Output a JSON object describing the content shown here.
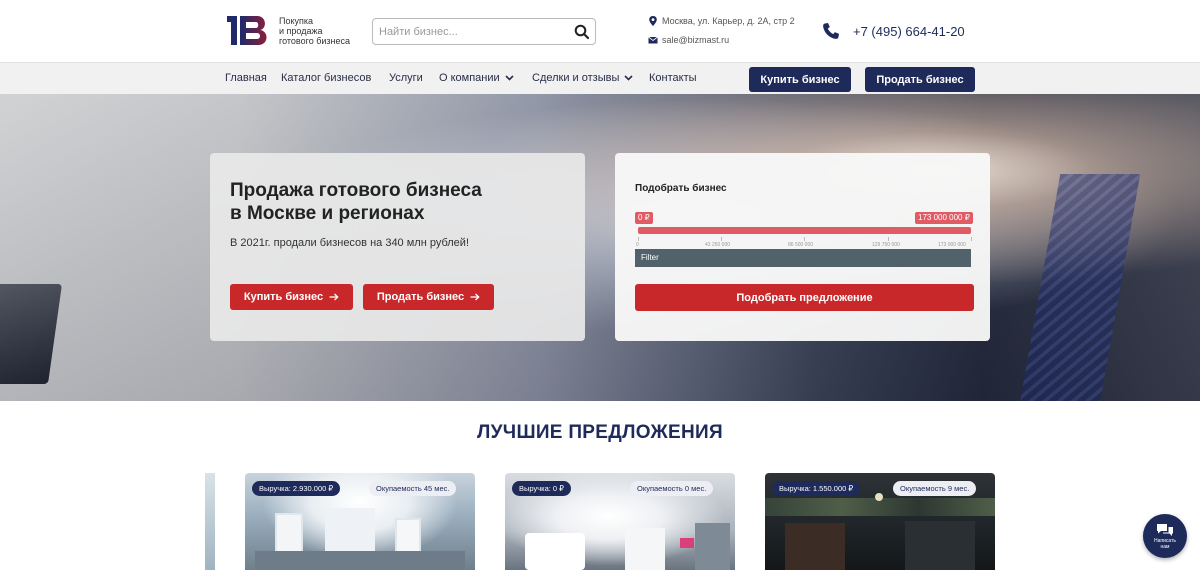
{
  "header": {
    "logo_text": "IB",
    "tagline": [
      "Покупка",
      "и продажа",
      "готового бизнеса"
    ],
    "search": {
      "placeholder": "Найти бизнес..."
    },
    "address": "Москва, ул. Карьер, д. 2А, стр 2",
    "email": "sale@bizmast.ru",
    "phone": "+7 (495) 664-41-20"
  },
  "nav": {
    "items": [
      {
        "label": "Главная"
      },
      {
        "label": "Каталог бизнесов"
      },
      {
        "label": "Услуги"
      },
      {
        "label": "О компании"
      },
      {
        "label": "Сделки и отзывы"
      },
      {
        "label": "Контакты"
      }
    ],
    "buy_button": "Купить бизнес",
    "sell_button": "Продать бизнес"
  },
  "hero": {
    "title_line1": "Продажа готового бизнеса",
    "title_line2": "в Москве и регионах",
    "subtitle": "В 2021г. продали бизнесов на 340 млн рублей!",
    "buy_button": "Купить бизнес",
    "sell_button": "Продать бизнес"
  },
  "filter": {
    "title": "Подобрать бизнес",
    "min_label": "0 ₽",
    "max_label": "173 000 000 ₽",
    "ticks": [
      "0",
      "43 250 000",
      "86 500 000",
      "129 750 000",
      "173 000 000"
    ],
    "filter_label": "Filter",
    "submit_button": "Подобрать предложение"
  },
  "best": {
    "title": "ЛУЧШИЕ ПРЕДЛОЖЕНИЯ",
    "cards": [
      {
        "revenue": "Выручка: 2.930.000 ₽",
        "payback": "Окупаемость 45 мес."
      },
      {
        "revenue": "Выручка: 0 ₽",
        "payback": "Окупаемость 0 мес."
      },
      {
        "revenue": "Выручка: 1.550.000 ₽",
        "payback": "Окупаемость 9 мес."
      }
    ]
  },
  "chat": {
    "label_line1": "Написать",
    "label_line2": "нам"
  },
  "colors": {
    "navy": "#1e2a5a",
    "red": "#c8282a",
    "slider": "#e15b64"
  },
  "icons": [
    "search-icon",
    "location-icon",
    "mail-icon",
    "phone-icon",
    "chevron-down-icon",
    "arrow-right-icon",
    "chat-icon"
  ]
}
